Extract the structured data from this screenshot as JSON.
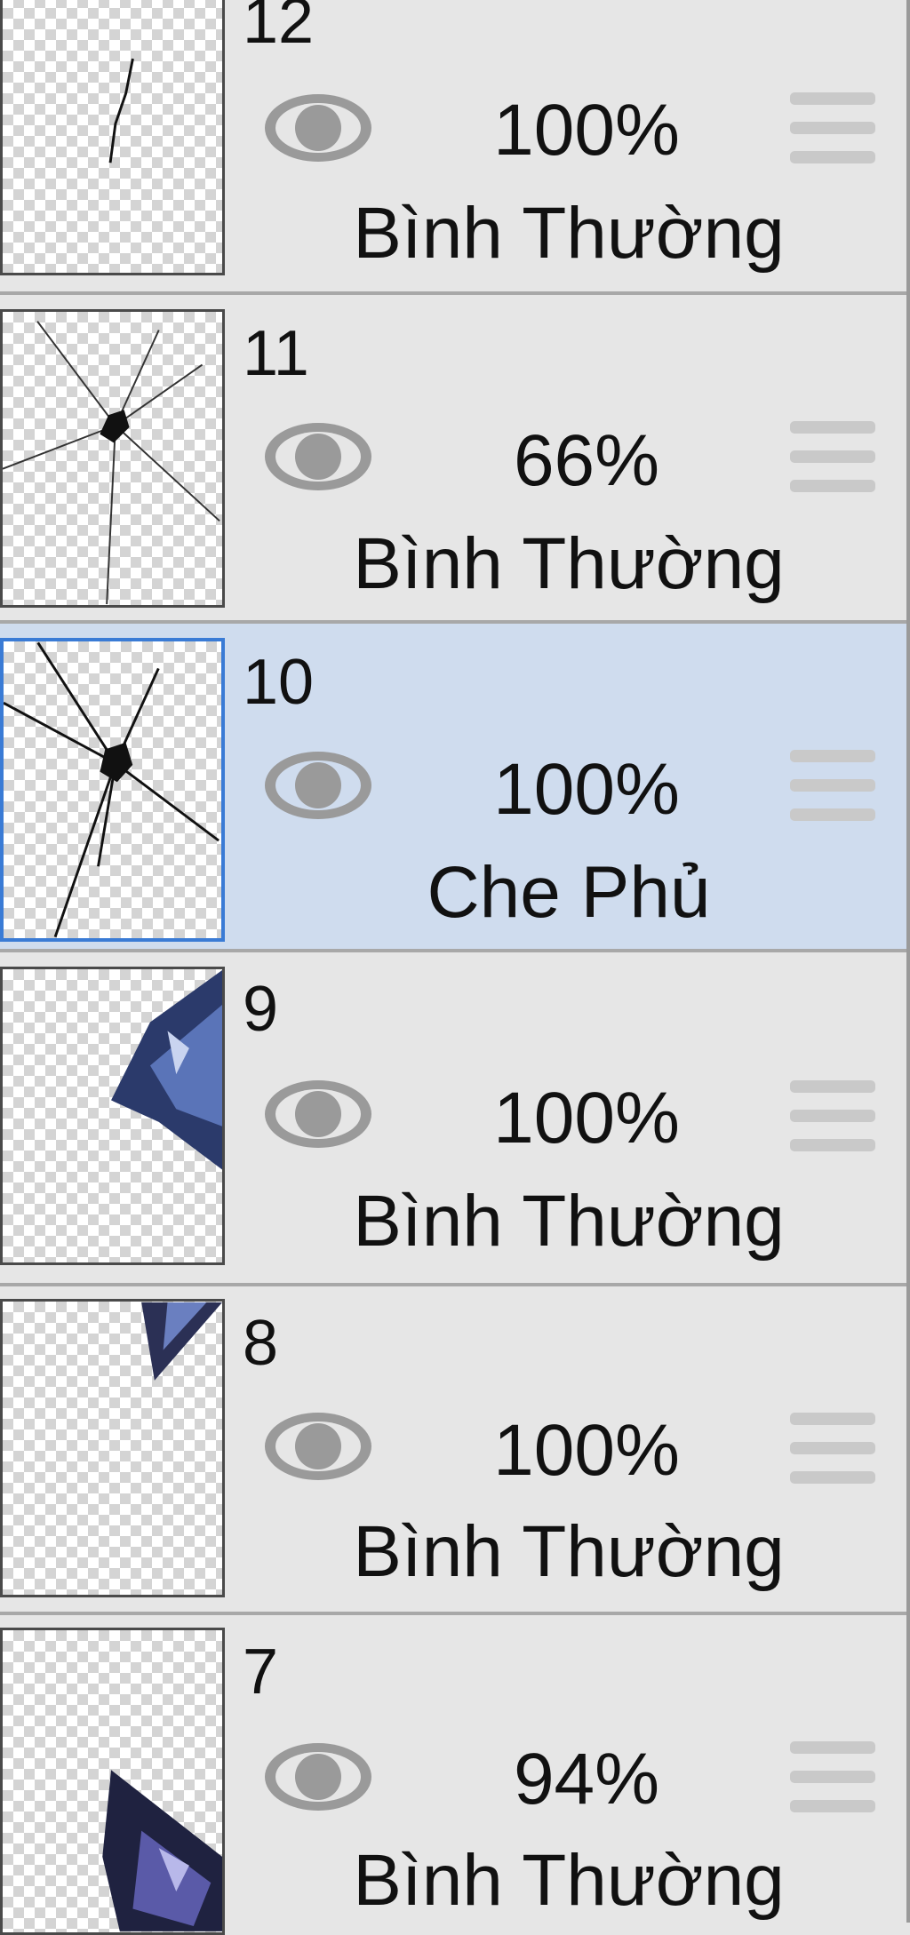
{
  "layers": [
    {
      "name": "12",
      "opacity": "100%",
      "blend_mode": "Bình Thường",
      "visible": true,
      "selected": false
    },
    {
      "name": "11",
      "opacity": "66%",
      "blend_mode": "Bình Thường",
      "visible": true,
      "selected": false
    },
    {
      "name": "10",
      "opacity": "100%",
      "blend_mode": "Che Phủ",
      "visible": true,
      "selected": true
    },
    {
      "name": "9",
      "opacity": "100%",
      "blend_mode": "Bình Thường",
      "visible": true,
      "selected": false
    },
    {
      "name": "8",
      "opacity": "100%",
      "blend_mode": "Bình Thường",
      "visible": true,
      "selected": false
    },
    {
      "name": "7",
      "opacity": "94%",
      "blend_mode": "Bình Thường",
      "visible": true,
      "selected": false
    }
  ],
  "colors": {
    "panel_background": "#e6e6e6",
    "selected_background": "#cfdcee",
    "selected_thumb_border": "#3a7bd5",
    "eye_icon": "#9a9a9a"
  },
  "icons": {
    "visibility": "eye-icon",
    "reorder": "drag-handle-icon"
  }
}
